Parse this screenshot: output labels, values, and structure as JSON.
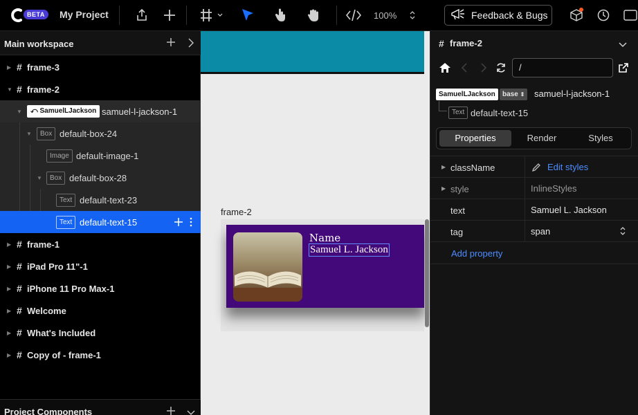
{
  "topbar": {
    "beta": "BETA",
    "project": "My Project",
    "zoom": "100%",
    "feedback": "Feedback & Bugs"
  },
  "left": {
    "title": "Main workspace",
    "rows": [
      {
        "label": "frame-3"
      },
      {
        "label": "frame-2"
      },
      {
        "chip": "SamuelLJackson",
        "label": "samuel-l-jackson-1"
      },
      {
        "tag": "Box",
        "label": "default-box-24"
      },
      {
        "tag": "Image",
        "label": "default-image-1"
      },
      {
        "tag": "Box",
        "label": "default-box-28"
      },
      {
        "tag": "Text",
        "label": "default-text-23"
      },
      {
        "tag": "Text",
        "label": "default-text-15"
      },
      {
        "label": "frame-1"
      },
      {
        "label": "iPad Pro 11\"-1"
      },
      {
        "label": "iPhone 11 Pro Max-1"
      },
      {
        "label": "Welcome"
      },
      {
        "label": "What's Included"
      },
      {
        "label": "Copy of - frame-1"
      }
    ],
    "bottom_title": "Project Components"
  },
  "canvas": {
    "frame_label": "frame-2",
    "card_name": "Name",
    "card_value": "Samuel L. Jackson"
  },
  "right": {
    "title": "frame-2",
    "path": "/",
    "component_chip": "SamuelLJackson",
    "base_chip": "base",
    "component_name": "samuel-l-jackson-1",
    "child_tag": "Text",
    "child_name": "default-text-15",
    "tabs": [
      "Properties",
      "Render",
      "Styles"
    ],
    "props": [
      {
        "key": "className",
        "value": "Edit styles"
      },
      {
        "key": "style",
        "value": "InlineStyles"
      },
      {
        "key": "text",
        "value": "Samuel L. Jackson"
      },
      {
        "key": "tag",
        "value": "span"
      }
    ],
    "add_property": "Add property"
  },
  "colors": {
    "selection": "#1463f3",
    "accent_link": "#4c8dff",
    "card_bg": "#43087a",
    "teal_frame": "#0b8ba6"
  }
}
